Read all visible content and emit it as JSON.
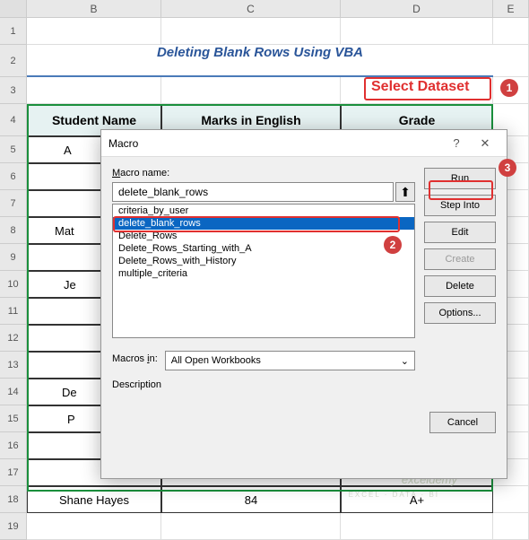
{
  "columns": {
    "b": "B",
    "c": "C",
    "d": "D",
    "e": "E"
  },
  "rows": [
    "1",
    "2",
    "3",
    "4",
    "5",
    "6",
    "7",
    "8",
    "9",
    "10",
    "11",
    "12",
    "13",
    "14",
    "15",
    "16",
    "17",
    "18",
    "19"
  ],
  "title": "Deleting Blank Rows Using VBA",
  "headers": {
    "name": "Student Name",
    "marks": "Marks in English",
    "grade": "Grade"
  },
  "partial": {
    "r5": "A",
    "r8": "Mat",
    "r10": "Je",
    "r14": "De",
    "r15": "P"
  },
  "last_row": {
    "name": "Shane Hayes",
    "marks": "84",
    "grade": "A+"
  },
  "annot": {
    "select": "Select Dataset",
    "b1": "1",
    "b2": "2",
    "b3": "3"
  },
  "dialog": {
    "title": "Macro",
    "name_label_u": "M",
    "name_label_rest": "acro name:",
    "name_value": "delete_blank_rows",
    "list": [
      "criteria_by_user",
      "delete_blank_rows",
      "Delete_Rows",
      "Delete_Rows_Starting_with_A",
      "Delete_Rows_with_History",
      "multiple_criteria"
    ],
    "macros_in_label": "Macros in:",
    "macros_in_label_u": "i",
    "macros_in_value": "All Open Workbooks",
    "description": "Description",
    "buttons": {
      "run": "Run",
      "step": "Step Into",
      "edit": "Edit",
      "create": "Create",
      "delete": "Delete",
      "options": "Options...",
      "cancel": "Cancel"
    }
  },
  "watermark": {
    "main": "exceldemy",
    "sub": "EXCEL · DATA · BI"
  }
}
